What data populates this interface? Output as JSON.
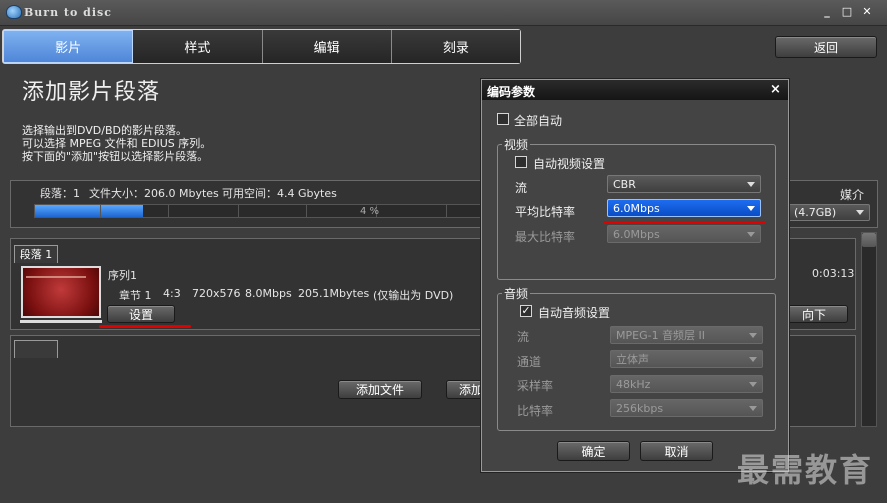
{
  "window": {
    "title": "Burn to disc"
  },
  "tabs": [
    {
      "label": "影片",
      "active": true
    },
    {
      "label": "样式",
      "active": false
    },
    {
      "label": "编辑",
      "active": false
    },
    {
      "label": "刻录",
      "active": false
    }
  ],
  "back_label": "返回",
  "page": {
    "heading": "添加影片段落",
    "desc_lines": [
      "选择输出到DVD/BD的影片段落。",
      "可以选择 MPEG 文件和 EDIUS 序列。",
      "按下面的\"添加\"按钮以选择影片段落。"
    ]
  },
  "info": {
    "segments": "段落：1",
    "file_size": "文件大小：206.0 Mbytes",
    "free_space": "可用空间：4.4 Gbytes",
    "percent": "4 %",
    "progress_fraction": 0.04
  },
  "media": {
    "label": "媒介",
    "value": "(4.7GB)"
  },
  "segment": {
    "tab_label": "段落 1",
    "seq_name": "序列1",
    "chapter": "章节 1",
    "aspect": "4:3",
    "resolution": "720x576",
    "bitrate": "8.0Mbps",
    "size": "205.1Mbytes",
    "note": "(仅输出为 DVD)",
    "duration": "0:03:13",
    "settings_label": "设置",
    "down_label": "向下"
  },
  "add_file_label": "添加文件",
  "add2_label": "添加",
  "dialog": {
    "title": "编码参数",
    "close": "×",
    "all_auto": "全部自动",
    "video_group": "视频",
    "auto_video": "自动视频设置",
    "stream_label": "流",
    "stream_value": "CBR",
    "avg_bitrate_label": "平均比特率",
    "avg_bitrate_value": "6.0Mbps",
    "max_bitrate_label": "最大比特率",
    "max_bitrate_value": "6.0Mbps",
    "audio_group": "音频",
    "auto_audio": "自动音频设置",
    "audio_stream_label": "流",
    "audio_stream_value": "MPEG-1 音频层 II",
    "channel_label": "通道",
    "channel_value": "立体声",
    "samplerate_label": "采样率",
    "samplerate_value": "48kHz",
    "audio_bitrate_label": "比特率",
    "audio_bitrate_value": "256kbps",
    "ok": "确定",
    "cancel": "取消"
  },
  "watermark": "最需教育",
  "colors": {
    "accent": "#4f86d8",
    "highlight": "#0a4cc4",
    "annotation": "#e00000"
  }
}
